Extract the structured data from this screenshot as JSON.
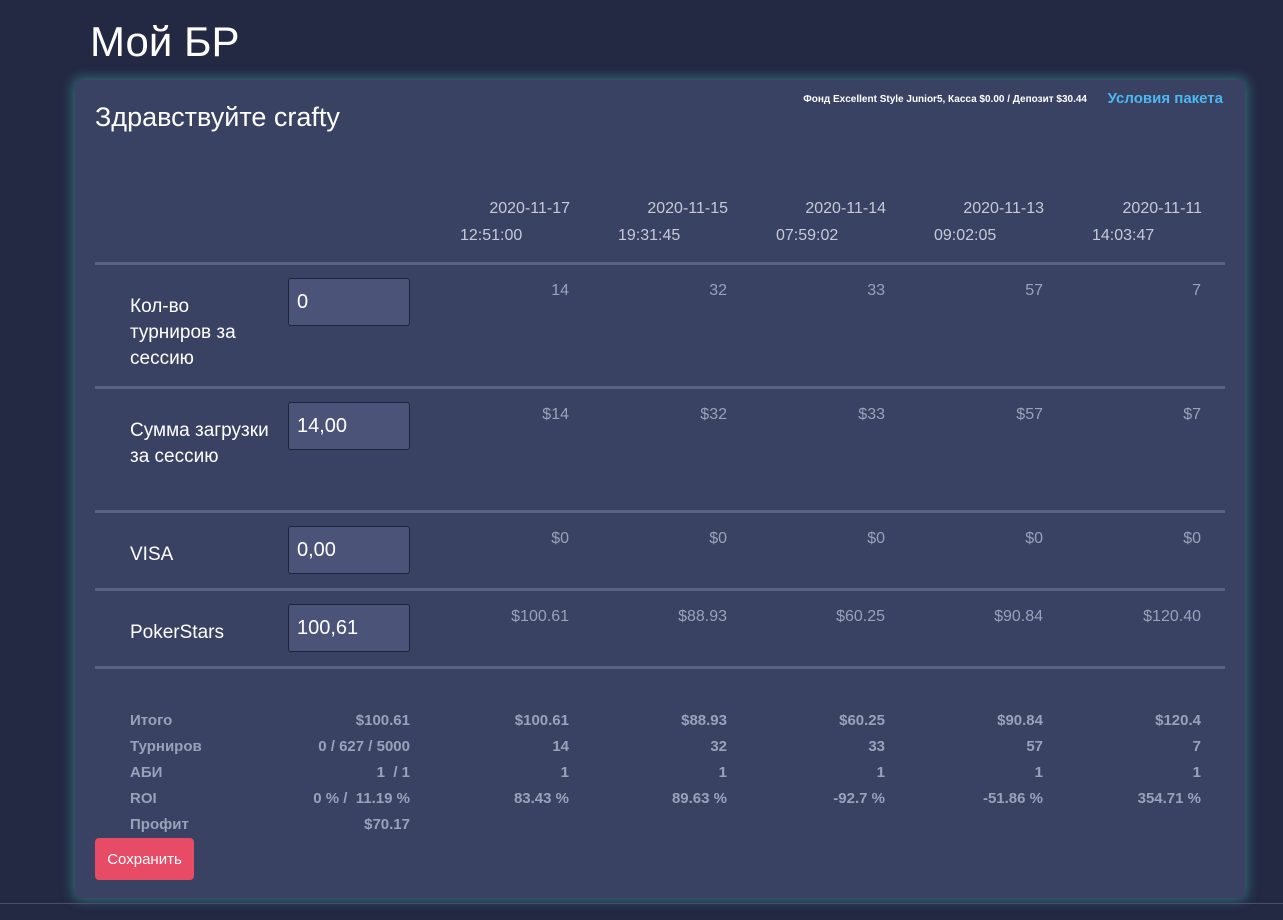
{
  "page": {
    "title": "Мой БР"
  },
  "header": {
    "greeting": "Здравствуйте crafty",
    "fund_info": "Фонд Excellent Style Junior5, Касса $0.00 / Депозит $30.44",
    "package_link": "Условия пакета"
  },
  "sessions": [
    {
      "date": "2020-11-17",
      "time": "12:51:00"
    },
    {
      "date": "2020-11-15",
      "time": "19:31:45"
    },
    {
      "date": "2020-11-14",
      "time": "07:59:02"
    },
    {
      "date": "2020-11-13",
      "time": "09:02:05"
    },
    {
      "date": "2020-11-11",
      "time": "14:03:47"
    }
  ],
  "rows": [
    {
      "label": "Кол-во турниров за сессию",
      "input_value": "0",
      "values": [
        "14",
        "32",
        "33",
        "57",
        "7"
      ]
    },
    {
      "label": "Сумма загрузки за сессию",
      "input_value": "14,00",
      "values": [
        "$14",
        "$32",
        "$33",
        "$57",
        "$7"
      ]
    },
    {
      "label": "VISA",
      "input_value": "0,00",
      "values": [
        "$0",
        "$0",
        "$0",
        "$0",
        "$0"
      ]
    },
    {
      "label": "PokerStars",
      "input_value": "100,61",
      "values": [
        "$100.61",
        "$88.93",
        "$60.25",
        "$90.84",
        "$120.40"
      ]
    }
  ],
  "summary": [
    {
      "label": "Итого",
      "current": "$100.61",
      "values": [
        "$100.61",
        "$88.93",
        "$60.25",
        "$90.84",
        "$120.4"
      ]
    },
    {
      "label": "Турниров",
      "current": "0 / 627 / 5000",
      "values": [
        "14",
        "32",
        "33",
        "57",
        "7"
      ]
    },
    {
      "label": "АБИ",
      "current": "1  / 1",
      "values": [
        "1",
        "1",
        "1",
        "1",
        "1"
      ]
    },
    {
      "label": "ROI",
      "current": "0 % /  11.19 %",
      "values": [
        "83.43 %",
        "89.63 %",
        "-92.7 %",
        "-51.86 %",
        "354.71 %"
      ]
    },
    {
      "label": "Профит",
      "current": "$70.17",
      "values": []
    }
  ],
  "actions": {
    "save_label": "Сохранить"
  }
}
